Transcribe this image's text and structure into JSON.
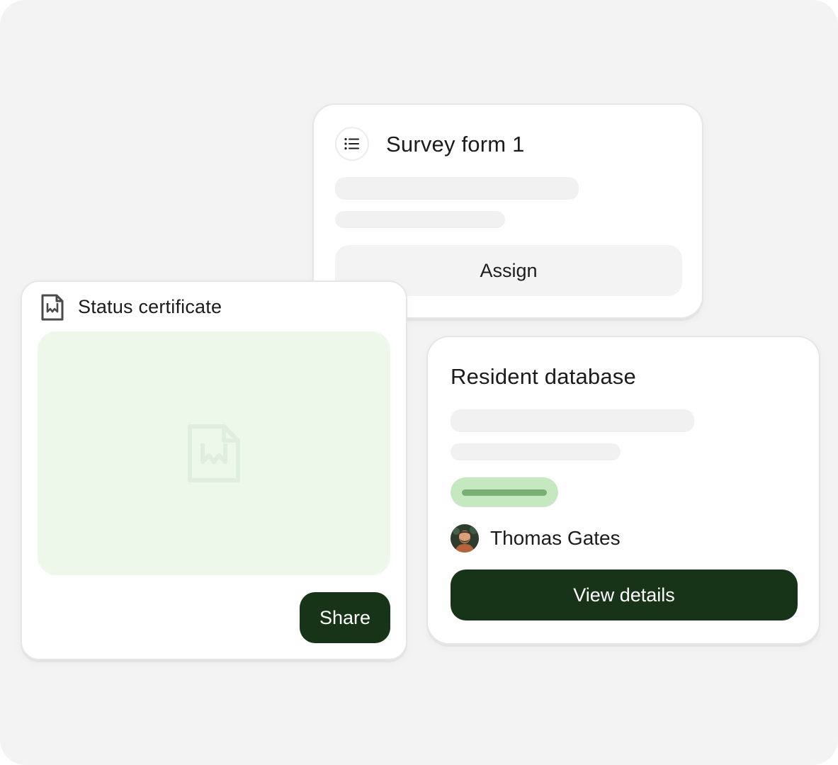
{
  "survey_card": {
    "title": "Survey form 1",
    "icon": "list-icon",
    "assign_label": "Assign"
  },
  "certificate_card": {
    "title": "Status certificate",
    "icon": "word-document-icon",
    "preview_icon": "word-document-icon",
    "share_label": "Share"
  },
  "resident_card": {
    "title": "Resident database",
    "person_name": "Thomas Gates",
    "view_label": "View details"
  },
  "colors": {
    "background": "#f3f3f3",
    "primary_button": "#173418",
    "preview_fill": "#eef8ea",
    "tag_fill": "#c5e8c0",
    "tag_bar": "#7aaf76"
  }
}
